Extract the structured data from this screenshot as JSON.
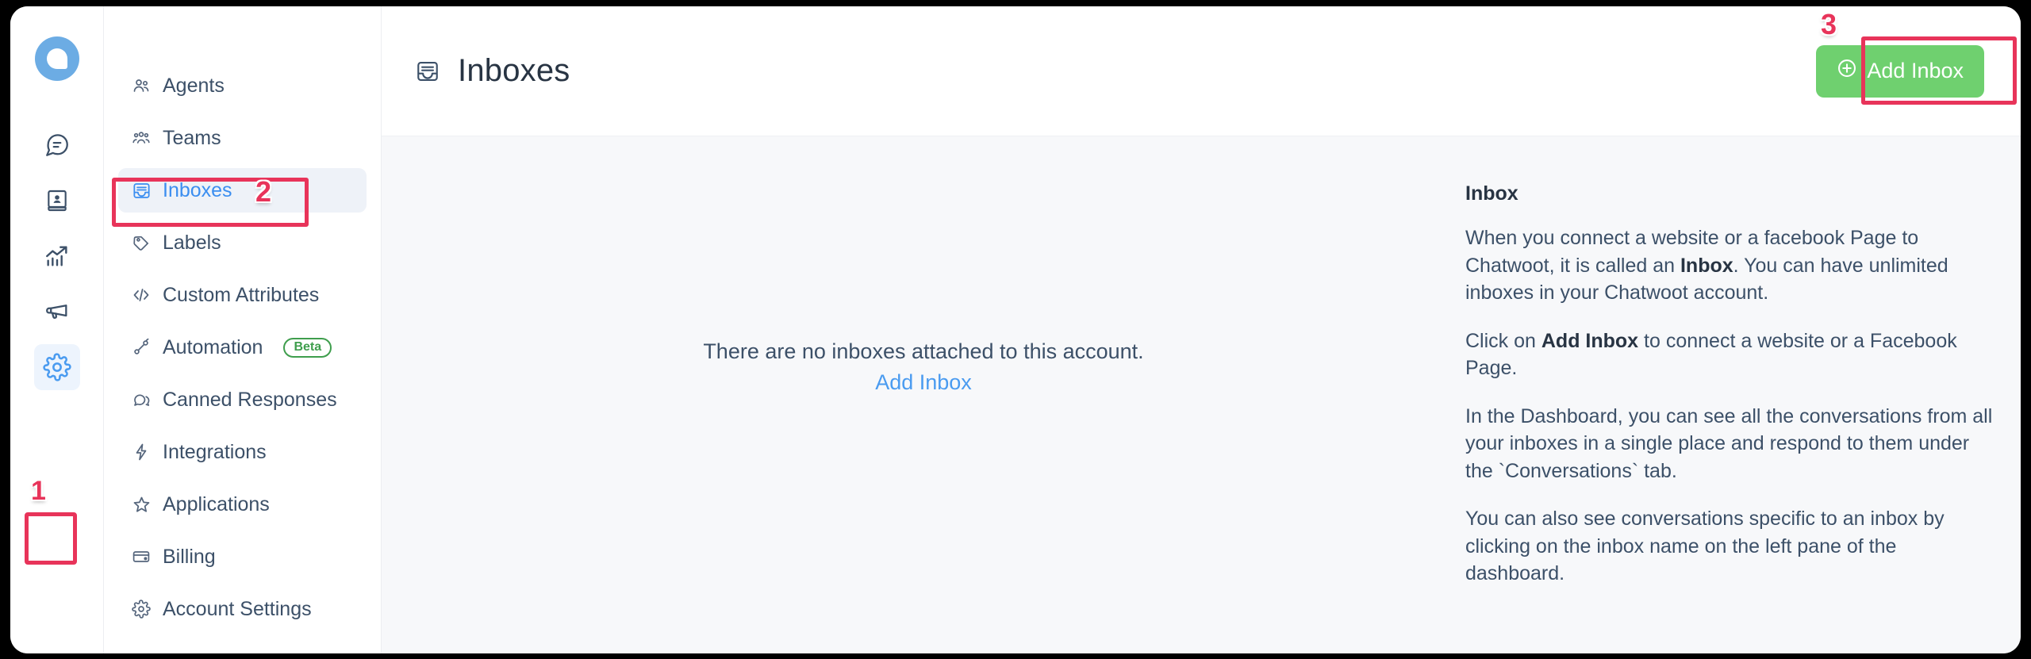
{
  "app": {
    "logo_name": "chatwoot-logo"
  },
  "rail": {
    "items": [
      {
        "name": "conversations",
        "icon": "chat-bubble-icon",
        "active": false
      },
      {
        "name": "contacts",
        "icon": "contacts-book-icon",
        "active": false
      },
      {
        "name": "reports",
        "icon": "reports-chart-icon",
        "active": false
      },
      {
        "name": "campaigns",
        "icon": "megaphone-icon",
        "active": false
      },
      {
        "name": "settings",
        "icon": "gear-icon",
        "active": true
      }
    ]
  },
  "sidebar": {
    "items": [
      {
        "label": "Agents",
        "icon": "agents-icon",
        "active": false,
        "badge": ""
      },
      {
        "label": "Teams",
        "icon": "teams-icon",
        "active": false,
        "badge": ""
      },
      {
        "label": "Inboxes",
        "icon": "inbox-icon",
        "active": true,
        "badge": ""
      },
      {
        "label": "Labels",
        "icon": "tag-icon",
        "active": false,
        "badge": ""
      },
      {
        "label": "Custom Attributes",
        "icon": "code-icon",
        "active": false,
        "badge": ""
      },
      {
        "label": "Automation",
        "icon": "automation-icon",
        "active": false,
        "badge": "Beta"
      },
      {
        "label": "Canned Responses",
        "icon": "canned-response-icon",
        "active": false,
        "badge": ""
      },
      {
        "label": "Integrations",
        "icon": "integrations-bolt-icon",
        "active": false,
        "badge": ""
      },
      {
        "label": "Applications",
        "icon": "applications-star-icon",
        "active": false,
        "badge": ""
      },
      {
        "label": "Billing",
        "icon": "billing-card-icon",
        "active": false,
        "badge": ""
      },
      {
        "label": "Account Settings",
        "icon": "gear-icon",
        "active": false,
        "badge": ""
      }
    ]
  },
  "header": {
    "title": "Inboxes",
    "title_icon": "inbox-icon",
    "add_button_label": "Add Inbox",
    "add_button_icon": "plus-circle-icon",
    "add_button_color": "#6fd06f"
  },
  "empty_state": {
    "message": "There are no inboxes attached to this account.",
    "link_label": "Add Inbox",
    "link_color": "#4a9bf0"
  },
  "info_panel": {
    "title": "Inbox",
    "paragraphs": [
      {
        "parts": [
          {
            "text": "When you connect a website or a facebook Page to Chatwoot, it is called an ",
            "bold": false
          },
          {
            "text": "Inbox",
            "bold": true
          },
          {
            "text": ". You can have unlimited inboxes in your Chatwoot account.",
            "bold": false
          }
        ]
      },
      {
        "parts": [
          {
            "text": "Click on ",
            "bold": false
          },
          {
            "text": "Add Inbox",
            "bold": true
          },
          {
            "text": " to connect a website or a Facebook Page.",
            "bold": false
          }
        ]
      },
      {
        "parts": [
          {
            "text": "In the Dashboard, you can see all the conversations from all your inboxes in a single place and respond to them under the `Conversations` tab.",
            "bold": false
          }
        ]
      },
      {
        "parts": [
          {
            "text": "You can also see conversations specific to an inbox by clicking on the inbox name on the left pane of the dashboard.",
            "bold": false
          }
        ]
      }
    ]
  },
  "annotations": {
    "marker_color": "#e8345a",
    "markers": [
      {
        "label": "1",
        "target": "settings-rail-icon"
      },
      {
        "label": "2",
        "target": "sidebar-item-inboxes"
      },
      {
        "label": "3",
        "target": "add-inbox-button"
      }
    ]
  }
}
